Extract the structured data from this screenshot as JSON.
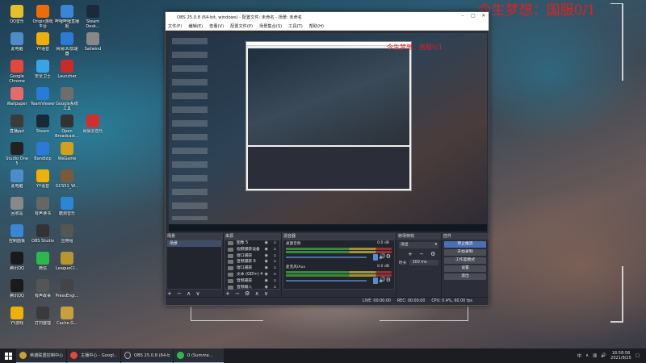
{
  "overlay": {
    "text": "今生梦想：国服0/1",
    "small_text": "今生梦想：国服0/1"
  },
  "desktop_icons": [
    {
      "label": "QQ音乐",
      "icon": "music-icon",
      "color": "#e6c02a"
    },
    {
      "label": "Origin游戏平台",
      "icon": "origin-icon",
      "color": "#f06c00"
    },
    {
      "label": "哔哩哔哩直播姬",
      "icon": "tv-icon",
      "color": "#3a86d6"
    },
    {
      "label": "Steam Desk...",
      "icon": "steam-icon",
      "color": "#1a2a3a"
    },
    {
      "label": "此电脑",
      "icon": "computer-icon",
      "color": "#4c8cc8"
    },
    {
      "label": "YY语音",
      "icon": "yy-icon",
      "color": "#f0b000"
    },
    {
      "label": "网易UU加速器",
      "icon": "uu-icon",
      "color": "#2b7bd6"
    },
    {
      "label": "Sailwind",
      "icon": "sail-icon",
      "color": "#888"
    },
    {
      "label": "Google Chrome",
      "icon": "chrome-icon",
      "color": "#e8453c"
    },
    {
      "label": "安全卫士",
      "icon": "shield-icon",
      "color": "#3aa3e3"
    },
    {
      "label": "Launcher",
      "icon": "launcher-icon",
      "color": "#cc2a2a"
    },
    {
      "label": "Wallpaper",
      "icon": "wallpaper-icon",
      "color": "#e26b6b"
    },
    {
      "label": "TeamViewer",
      "icon": "teamviewer-icon",
      "color": "#2a7bd6"
    },
    {
      "label": "Google系统工具",
      "icon": "gear-icon",
      "color": "#6d6d6d"
    },
    {
      "label": "直播ppt",
      "icon": "ppt-icon",
      "color": "#3b3b3b"
    },
    {
      "label": "Steam",
      "icon": "steam-icon",
      "color": "#1b2838"
    },
    {
      "label": "Open Broadcast...",
      "icon": "obs-icon",
      "color": "#333"
    },
    {
      "label": "网易云音乐",
      "icon": "cloudmusic-icon",
      "color": "#d32f2f"
    },
    {
      "label": "Studio One 5",
      "icon": "studio-icon",
      "color": "#222"
    },
    {
      "label": "Bandizip",
      "icon": "bandizip-icon",
      "color": "#2b7bd6"
    },
    {
      "label": "WeGame",
      "icon": "wegame-icon",
      "color": "#d4a017"
    },
    {
      "label": "此电脑",
      "icon": "pc-icon",
      "color": "#4c8cc8"
    },
    {
      "label": "YY语音",
      "icon": "yy2-icon",
      "color": "#f0b000"
    },
    {
      "label": "GCS51_W...",
      "icon": "gcs-icon",
      "color": "#7a5a3a"
    },
    {
      "label": "回收站",
      "icon": "recycle-icon",
      "color": "#888"
    },
    {
      "label": "有声读书",
      "icon": "book-icon",
      "color": "#666"
    },
    {
      "label": "酷狗音乐",
      "icon": "kugou-icon",
      "color": "#2b86d6"
    },
    {
      "label": "控制面板",
      "icon": "control-icon",
      "color": "#3a86d6"
    },
    {
      "label": "OBS Studio",
      "icon": "obs-icon",
      "color": "#333"
    },
    {
      "label": "应用组",
      "icon": "apps-icon",
      "color": "#555"
    },
    {
      "label": "腾讯QQ",
      "icon": "penguin-icon",
      "color": "#1a1a1a"
    },
    {
      "label": "微信",
      "icon": "wechat-icon",
      "color": "#2db84d"
    },
    {
      "label": "LeagueCl...",
      "icon": "league-icon",
      "color": "#b8962e"
    },
    {
      "label": "腾讯QQ",
      "icon": "qq-icon",
      "color": "#1a1a1a"
    },
    {
      "label": "有声故事",
      "icon": "story-icon",
      "color": "#555"
    },
    {
      "label": "PressEngi...",
      "icon": "press-icon",
      "color": "#444"
    },
    {
      "label": "YY游戏",
      "icon": "yygame-icon",
      "color": "#f0b000"
    },
    {
      "label": "打扫整理",
      "icon": "clean-icon",
      "color": "#3a3a3a"
    },
    {
      "label": "Cache G...",
      "icon": "cache-icon",
      "color": "#c8a03a"
    }
  ],
  "obs": {
    "title": "OBS 25.0.8 (64-bit, windows) - 配置文件: 未命名 - 场景: 未命名",
    "menu": [
      "文件(F)",
      "编辑(E)",
      "查看(V)",
      "配置文件(P)",
      "场景集合(S)",
      "工具(T)",
      "帮助(H)"
    ],
    "docks": {
      "scenes": {
        "title": "场景",
        "items": [
          "场景"
        ]
      },
      "sources": {
        "title": "来源",
        "items": [
          "图像 5",
          "视频捕获设备",
          "窗口捕获",
          "音频捕获 6",
          "窗口捕获",
          "文本 (GDI+) 4",
          "音频捕获",
          "音频输入"
        ]
      },
      "mixer": {
        "title": "混音器",
        "items": [
          {
            "name": "桌面音频",
            "db": "0.0 dB"
          },
          {
            "name": "麦克风/Aux",
            "db": "0.0 dB"
          }
        ]
      },
      "transitions": {
        "title": "转场特效",
        "type": "淡出",
        "duration_label": "时长",
        "duration": "300 ms"
      },
      "controls": {
        "title": "控件",
        "buttons": [
          "停止推流",
          "开始录制",
          "工作室模式",
          "设置",
          "退出"
        ]
      }
    },
    "status": {
      "live": "LIVE: 00:00:00",
      "rec": "REC: 00:00:00",
      "cpu": "CPU: 0.4%, 60.00 fps"
    }
  },
  "taskbar": {
    "apps": [
      {
        "label": "英雄联盟控制中心",
        "color": "#c9a227"
      },
      {
        "label": "主播中心 - Googl...",
        "color": "#e8453c"
      },
      {
        "label": "OBS 25.0.8 (64-bi...",
        "color": "#333"
      },
      {
        "label": "0 (Summe...",
        "color": "#2db84d"
      }
    ],
    "tray": {
      "ime": "中",
      "time": "18:58:58",
      "date": "2021/8/25"
    }
  }
}
